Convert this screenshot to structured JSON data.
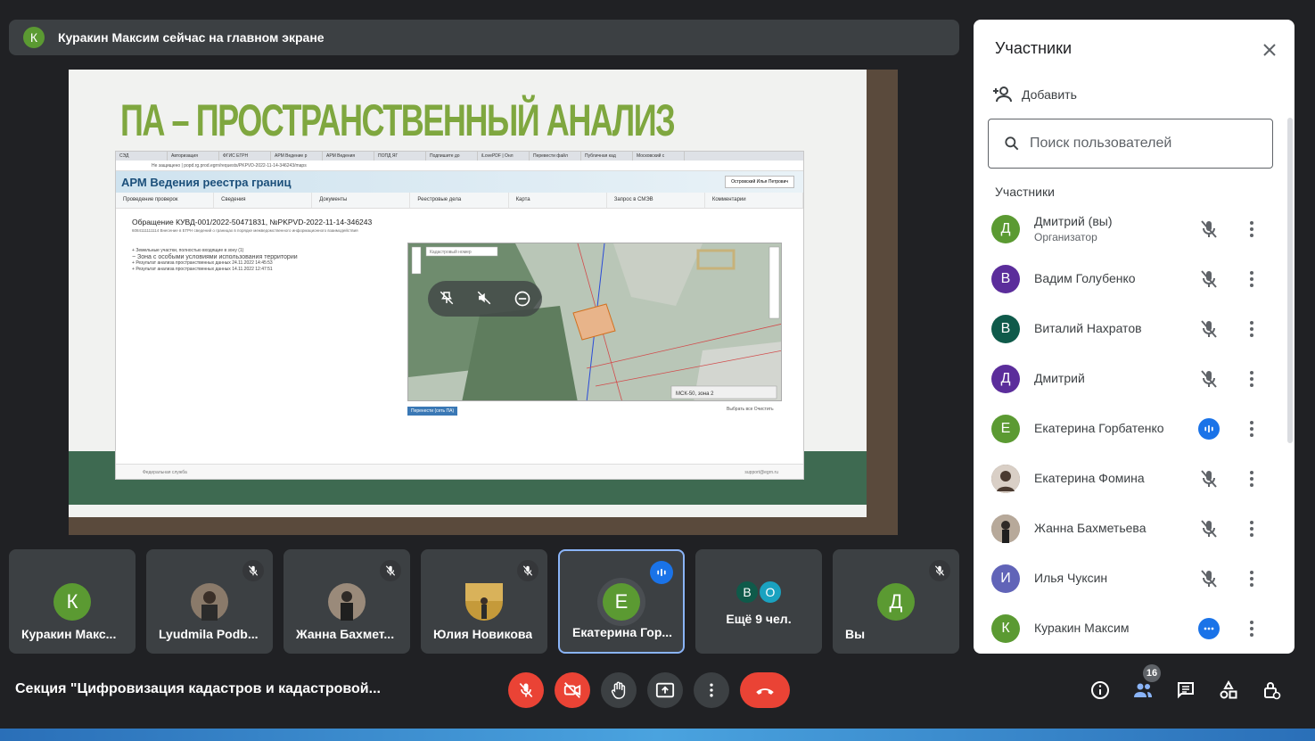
{
  "colors": {
    "background": "#202124",
    "surface": "#3c4043",
    "panel": "#ffffff",
    "accent_blue": "#1a73e8",
    "danger_red": "#ea4335",
    "avatar_green": "#5b9a32",
    "avatar_purple": "#5b2d9b",
    "avatar_teal": "#0f5a4a",
    "avatar_violet": "#6164b8"
  },
  "banner": {
    "avatar_letter": "К",
    "text": "Куракин Максим сейчас на главном экране"
  },
  "slide": {
    "title": "ПА – ПРОСТРАНСТВЕННЫЙ АНАЛИЗ",
    "browser_tabs": [
      "СЭД",
      "Авторизация",
      "ФГИС ЕГРН",
      "АРМ Ведение р",
      "АРМ Ведения",
      "ПОПД ЯГ",
      "Подпишите до",
      "iLovePDF | Онл",
      "Перевести файл",
      "Публичная кад",
      "Московский с"
    ],
    "address": "Не защищено | popd.rg.prod.egrn/requests/PKPVD-2022-11-14-346243/maps",
    "app_title": "АРМ Ведения реестра границ",
    "user_name": "Островский Илья Петрович",
    "nav": [
      "Проведение проверок",
      "Сведения",
      "Документы",
      "Реестровые дела",
      "Карта",
      "Запрос в СМЭВ",
      "Комментарии"
    ],
    "request_title": "Обращение КУВД-001/2022-50471831, №PKPVD-2022-11-14-346243",
    "request_sub": "6084111111114 Внесение в ЕГРН сведений о границах в порядке межведомственного информационного взаимодействия",
    "tree": [
      "Земельные участки, полностью входящие в зону (1)",
      "Зона с особыми условиями использования территории",
      "Результат анализа пространственных данных 24.11.2022 14:45:53",
      "Результат анализа пространственных данных 14.11.2022 12:47:51"
    ],
    "map_search_placeholder": "Кадастровый номер",
    "map_zone": "МСК-50, зона 2",
    "map_button": "Перенести (сеть ПА)",
    "map_links": "Выбрать все   Очистить",
    "footer_left": "Федеральная служба",
    "footer_right": "support@egrn.ru"
  },
  "tiles": [
    {
      "name": "Куракин Макс...",
      "letter": "К",
      "color": "#5b9a32",
      "muted": false
    },
    {
      "name": "Lyudmila Podb...",
      "letter": "",
      "color": "#8a7a6a",
      "muted": true
    },
    {
      "name": "Жанна Бахмет...",
      "letter": "",
      "color": "#9a8a7a",
      "muted": true
    },
    {
      "name": "Юлия Новикова",
      "letter": "",
      "color": "#c59a3a",
      "muted": true
    },
    {
      "name": "Екатерина Гор...",
      "letter": "Е",
      "color": "#5b9a32",
      "speaking": true
    },
    {
      "name": "Вы",
      "letter": "Д",
      "color": "#5b9a32",
      "muted": true
    }
  ],
  "more_tile": {
    "label": "Ещё 9 чел.",
    "letters": [
      "В",
      "О"
    ]
  },
  "panel": {
    "title": "Участники",
    "add_label": "Добавить",
    "search_placeholder": "Поиск пользователей",
    "section_label": "Участники",
    "participants": [
      {
        "name": "Дмитрий (вы)",
        "role": "Организатор",
        "letter": "Д",
        "color": "#5b9a32",
        "state": "muted"
      },
      {
        "name": "Вадим Голубенко",
        "letter": "В",
        "color": "#5b2d9b",
        "state": "muted"
      },
      {
        "name": "Виталий Нахратов",
        "letter": "В",
        "color": "#0f5a4a",
        "state": "muted"
      },
      {
        "name": "Дмитрий",
        "letter": "Д",
        "color": "#5b2d9b",
        "state": "muted"
      },
      {
        "name": "Екатерина Горбатенко",
        "letter": "Е",
        "color": "#5b9a32",
        "state": "speaking"
      },
      {
        "name": "Екатерина Фомина",
        "letter": "",
        "color": "#6b5a4e",
        "state": "muted"
      },
      {
        "name": "Жанна Бахметьева",
        "letter": "",
        "color": "#8c7a6a",
        "state": "muted"
      },
      {
        "name": "Илья Чуксин",
        "letter": "И",
        "color": "#6164b8",
        "state": "muted"
      },
      {
        "name": "Куракин Максим",
        "letter": "К",
        "color": "#5b9a32",
        "state": "presenting"
      }
    ]
  },
  "meeting": {
    "title": "Секция \"Цифровизация кадастров и кадастровой...",
    "participants_count": "16"
  }
}
